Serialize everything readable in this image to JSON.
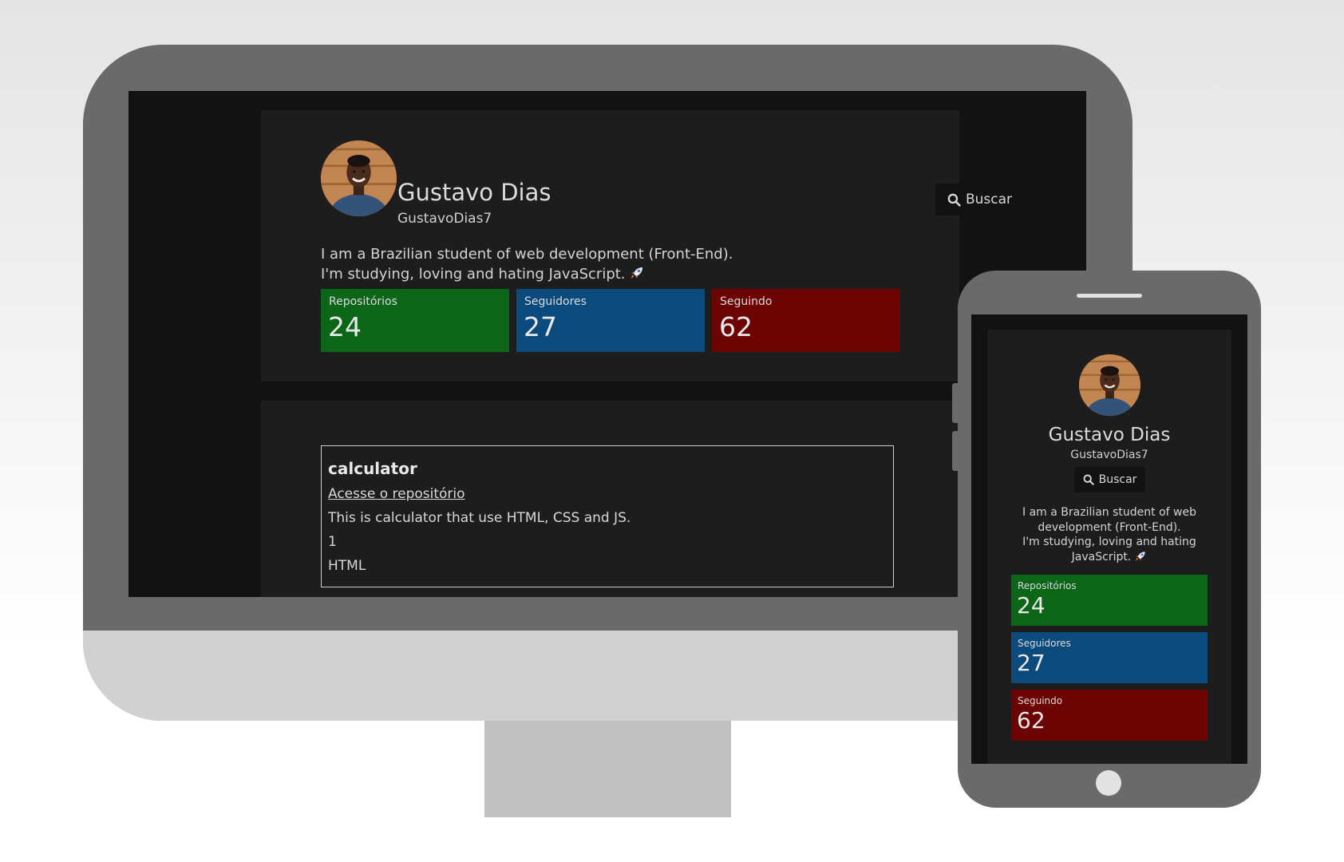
{
  "profile": {
    "name": "Gustavo Dias",
    "username": "GustavoDias7",
    "bio_line1": "I am a Brazilian student of web development (Front-End).",
    "bio_line2": "I'm studying, loving and hating JavaScript.",
    "search_label": "Buscar",
    "icons": {
      "search": "search-icon",
      "bio_emoji": "rocket-icon"
    }
  },
  "stats": [
    {
      "label": "Repositórios",
      "value": "24",
      "color": "#0b6617"
    },
    {
      "label": "Seguidores",
      "value": "27",
      "color": "#0b4a7d"
    },
    {
      "label": "Seguindo",
      "value": "62",
      "color": "#6c0404"
    }
  ],
  "repos": [
    {
      "name": "calculator",
      "link_label": "Acesse o repositório",
      "description": "This is calculator that use HTML, CSS and JS.",
      "stars": "1",
      "language": "HTML"
    }
  ],
  "mobile_bio": {
    "lines": [
      "I am a Brazilian student of web",
      "development (Front-End).",
      "I'm studying, loving and hating",
      "JavaScript."
    ]
  },
  "colors": {
    "page_bg": "#121212",
    "card_bg": "#1e1d1e",
    "device_frame": "#6a6a6a",
    "monitor_chin": "#d1d1d1",
    "monitor_stand": "#c0c0c0"
  }
}
